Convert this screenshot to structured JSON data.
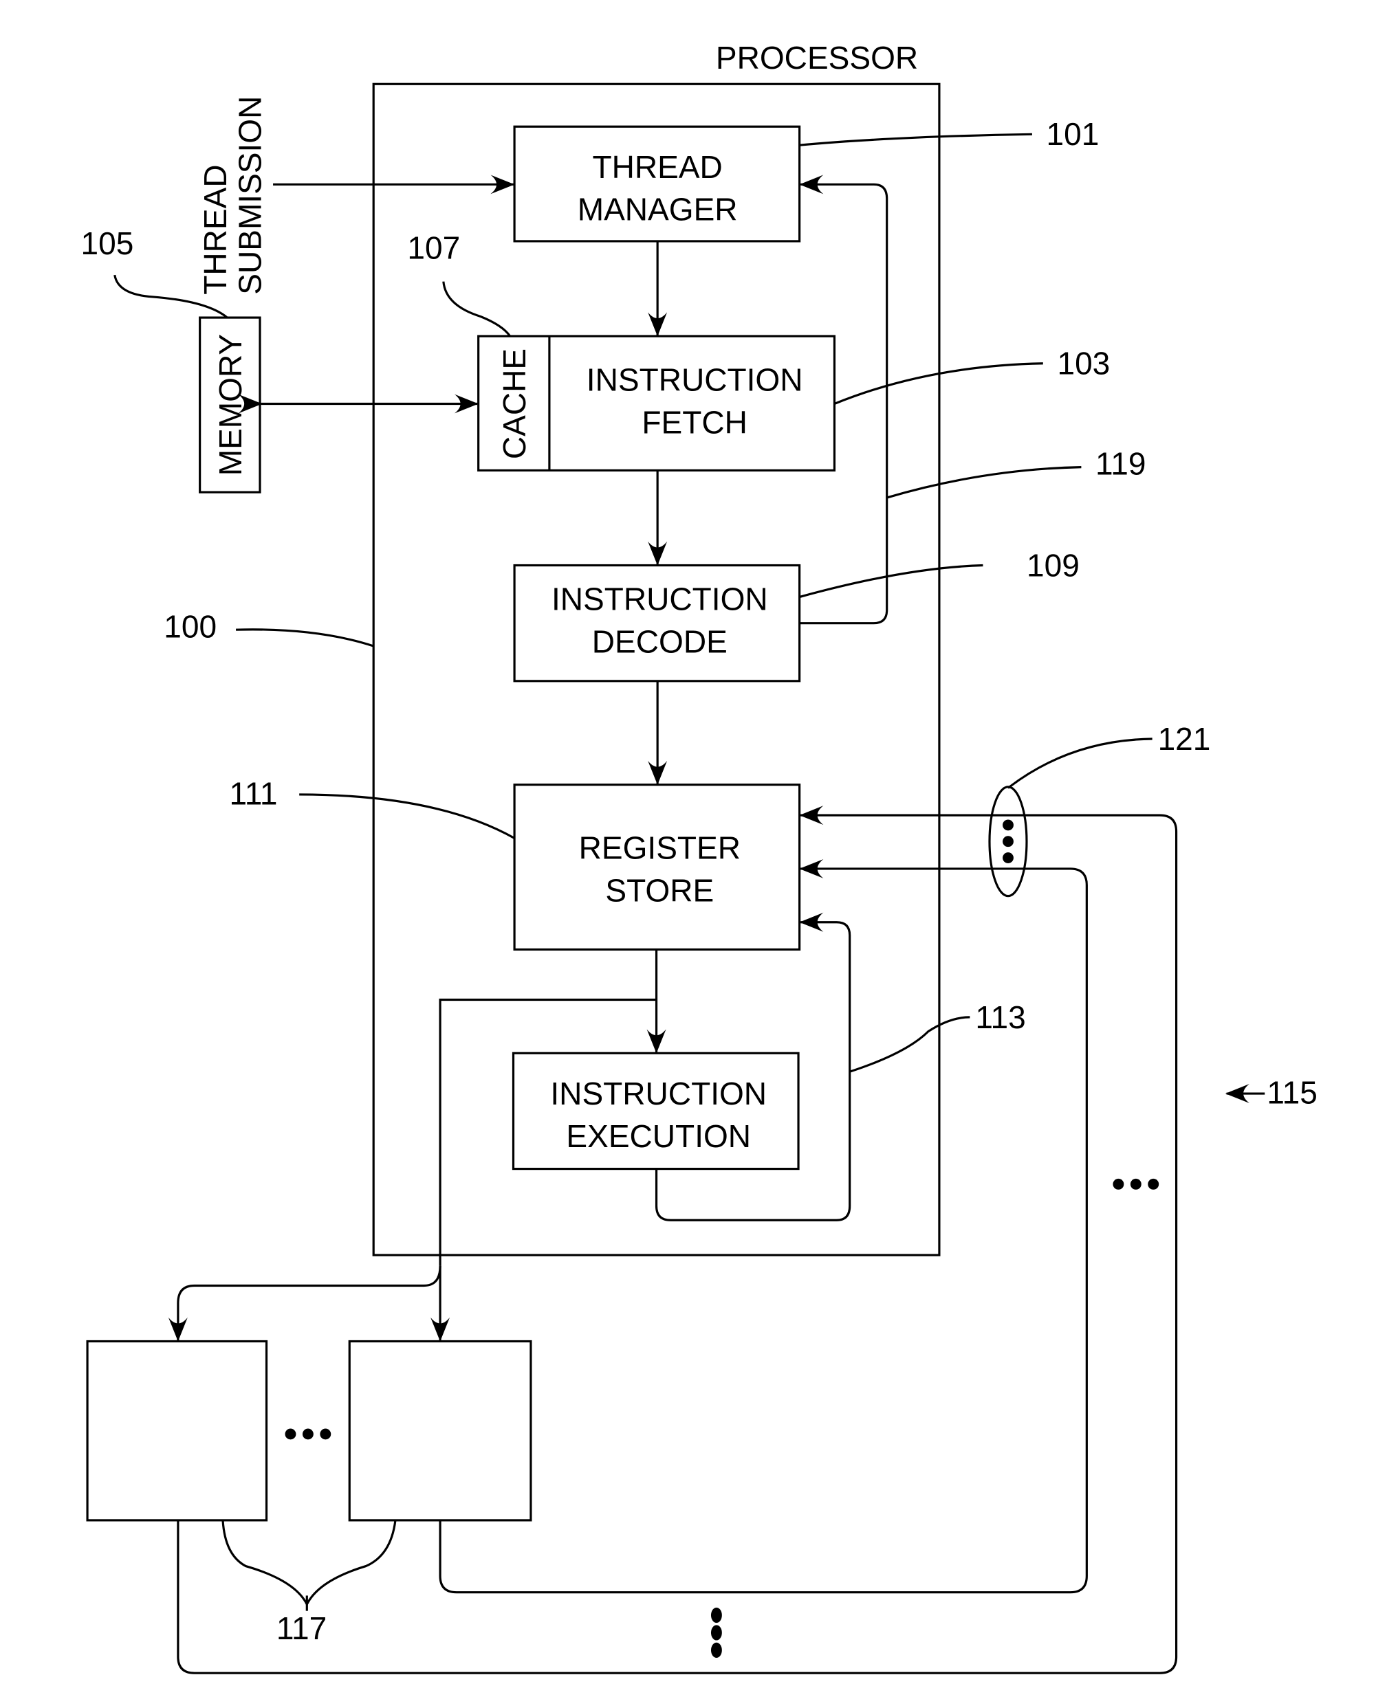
{
  "figure": {
    "processor_title": "PROCESSOR",
    "thread_submission": [
      "THREAD",
      "SUBMISSION"
    ],
    "blocks": {
      "thread_manager": [
        "THREAD",
        "MANAGER"
      ],
      "cache": "CACHE",
      "instruction_fetch": [
        "INSTRUCTION",
        "FETCH"
      ],
      "memory": "MEMORY",
      "instruction_decode": [
        "INSTRUCTION",
        "DECODE"
      ],
      "register_store": [
        "REGISTER",
        "STORE"
      ],
      "instruction_execution": [
        "INSTRUCTION",
        "EXECUTION"
      ]
    },
    "reference_numerals": {
      "processor": "100",
      "thread_manager": "101",
      "instruction_fetch": "103",
      "memory": "105",
      "cache": "107",
      "instruction_decode": "109",
      "register_store": "111",
      "execution_loop": "113",
      "system": "115",
      "external_units": "117",
      "decode_feedback": "119",
      "return_paths": "121"
    },
    "ellipsis": "•••"
  }
}
